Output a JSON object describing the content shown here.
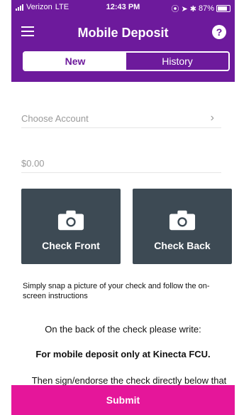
{
  "status": {
    "carrier": "Verizon",
    "network": "LTE",
    "time": "12:43 PM",
    "battery": "87%"
  },
  "header": {
    "title": "Mobile Deposit",
    "help_label": "?"
  },
  "tabs": [
    "New",
    "History"
  ],
  "form": {
    "choose_account": "Choose Account",
    "amount": "$0.00"
  },
  "capture": {
    "front_label": "Check Front",
    "back_label": "Check Back"
  },
  "instructions": "Simply snap a picture of your check and follow the on-screen instructions",
  "endorse": {
    "line1": "On the back of the check please write:",
    "line2": "For mobile deposit only at Kinecta FCU.",
    "line3": "Then sign/endorse the check directly below that"
  },
  "footer": {
    "submit_label": "Submit"
  }
}
